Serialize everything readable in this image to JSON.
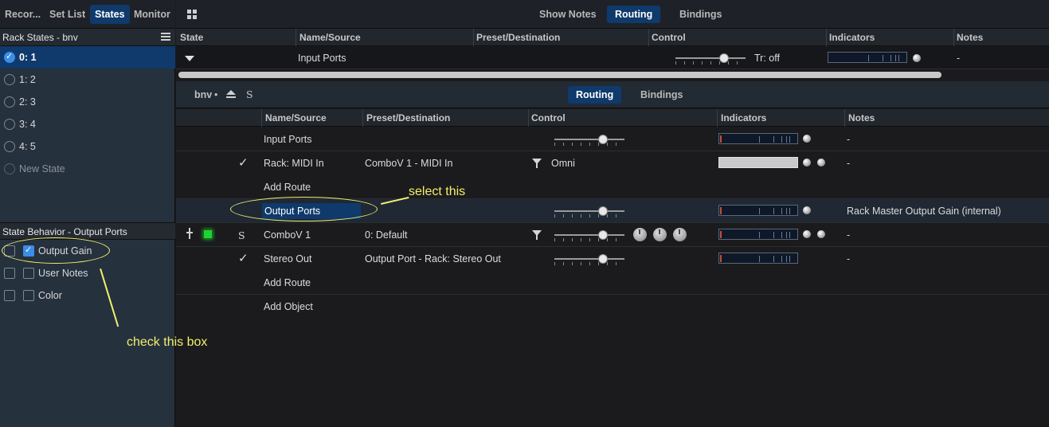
{
  "left_tabs": [
    "Recor...",
    "Set List",
    "States",
    "Monitor"
  ],
  "rack_states": {
    "title": "Rack States - bnv",
    "items": [
      {
        "label": "0: 1",
        "checked": true
      },
      {
        "label": "1: 2",
        "checked": false
      },
      {
        "label": "2: 3",
        "checked": false
      },
      {
        "label": "3: 4",
        "checked": false
      },
      {
        "label": "4: 5",
        "checked": false
      }
    ],
    "new_state": "New State"
  },
  "state_behavior": {
    "title": "State Behavior - Output Ports",
    "items": [
      {
        "label": "Output Gain",
        "checked": true
      },
      {
        "label": "User Notes",
        "checked": false
      },
      {
        "label": "Color",
        "checked": false
      }
    ]
  },
  "top_tabs": {
    "show_notes": "Show Notes",
    "routing": "Routing",
    "bindings": "Bindings"
  },
  "top_headers": [
    "State",
    "Name/Source",
    "Preset/Destination",
    "Control",
    "Indicators",
    "Notes"
  ],
  "top_row": {
    "name": "Input Ports",
    "control_text": "Tr: off",
    "slider": 0.72,
    "notes": "-"
  },
  "sub_bar": {
    "rack": "bnv",
    "dot": "•",
    "s": "S",
    "routing": "Routing",
    "bindings": "Bindings"
  },
  "inner_headers": [
    "Name/Source",
    "Preset/Destination",
    "Control",
    "Indicators",
    "Notes"
  ],
  "rows": {
    "input_ports": {
      "name": "Input Ports",
      "notes": "-",
      "slider": 0.72
    },
    "midi_in": {
      "name": "Rack: MIDI In",
      "dest": "ComboV 1 - MIDI In",
      "control": "Omni",
      "notes": "-"
    },
    "add_route_1": {
      "name": "Add Route"
    },
    "output_ports": {
      "name": "Output Ports",
      "notes": "Rack Master Output Gain (internal)",
      "slider": 0.72
    },
    "combov": {
      "s": "S",
      "name": "ComboV 1",
      "dest": "0: Default",
      "notes": "-",
      "slider": 0.72
    },
    "stereo_out": {
      "name": "Stereo Out",
      "dest": "Output Port - Rack: Stereo Out",
      "notes": "-",
      "slider": 0.72
    },
    "add_route_2": {
      "name": "Add Route"
    },
    "add_object": {
      "name": "Add Object"
    }
  },
  "annotations": {
    "select_this": "select this",
    "check_this_box": "check this box"
  },
  "colors": {
    "accent": "#0f3a6b",
    "annotation": "#f2ef6c",
    "checkbox": "#3b8de6",
    "led_green": "#22d133"
  }
}
